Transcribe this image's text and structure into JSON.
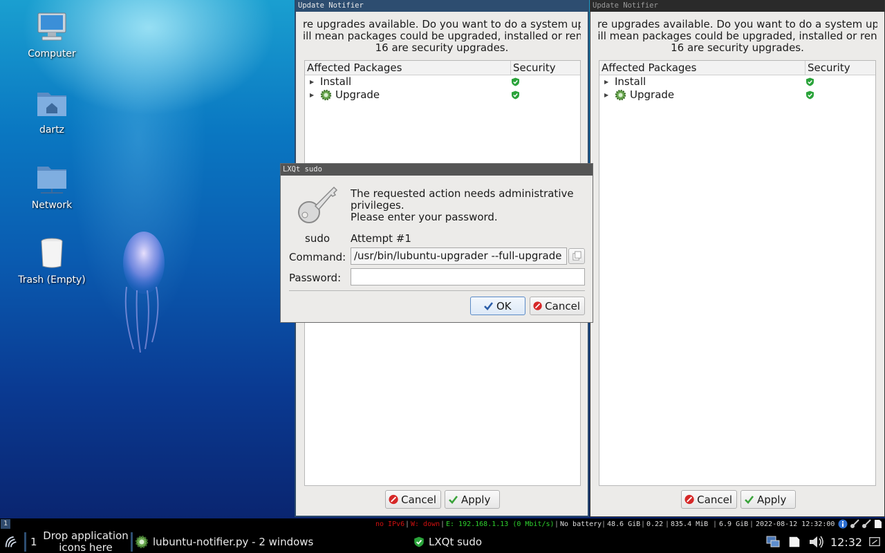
{
  "desktop": {
    "icons": [
      {
        "label": "Computer",
        "icon": "computer-icon"
      },
      {
        "label": "dartz",
        "icon": "home-folder-icon"
      },
      {
        "label": "Network",
        "icon": "network-folder-icon"
      },
      {
        "label": "Trash (Empty)",
        "icon": "trash-icon"
      }
    ]
  },
  "updater": {
    "title": "Update Notifier",
    "message_line1": "re upgrades available. Do you want to do a system up",
    "message_line2": "ill mean packages could be upgraded, installed or ren",
    "message_line3": "16 are security upgrades.",
    "col_packages": "Affected Packages",
    "col_security": "Security",
    "rows": [
      {
        "label": "Install",
        "icon": "shield-icon"
      },
      {
        "label": "Upgrade",
        "icon": "gear-icon"
      }
    ],
    "cancel_label": "Cancel",
    "apply_label": "Apply"
  },
  "sudo": {
    "title": "LXQt sudo",
    "prompt_line1": "The requested action needs administrative",
    "prompt_line2": "privileges.",
    "prompt_line3": "Please enter your password.",
    "user": "sudo",
    "attempt": "Attempt #1",
    "command_label": "Command:",
    "command_value": "/usr/bin/lubuntu-upgrader --full-upgrade",
    "password_label": "Password:",
    "password_value": "",
    "ok_label": "OK",
    "cancel_label": "Cancel"
  },
  "taskbar": {
    "workspace_indicator": "1",
    "status": {
      "ipv6": "no IPv6",
      "wifi": "W: down",
      "ethernet": "E: 192.168.1.13 (0 Mbit/s)",
      "battery": "No battery",
      "disk": "48.6 GiB",
      "load": "0.22",
      "mem": "835.4 MiB",
      "swap": "6.9 GiB",
      "datetime": "2022-08-12 12:32:00"
    },
    "desktop_number": "1",
    "quicklaunch_text": "Drop application icons here",
    "tasks": [
      {
        "label": "lubuntu-notifier.py - 2 windows",
        "icon": "gear-icon"
      },
      {
        "label": "LXQt sudo",
        "icon": "shield-icon"
      }
    ],
    "clock": "12:32"
  },
  "colors": {
    "title_active": "#2d4d70",
    "title_inactive": "#2a2a2a",
    "security_green": "#2aa33a",
    "status_red": "#d01010",
    "status_green": "#2ed02e"
  }
}
